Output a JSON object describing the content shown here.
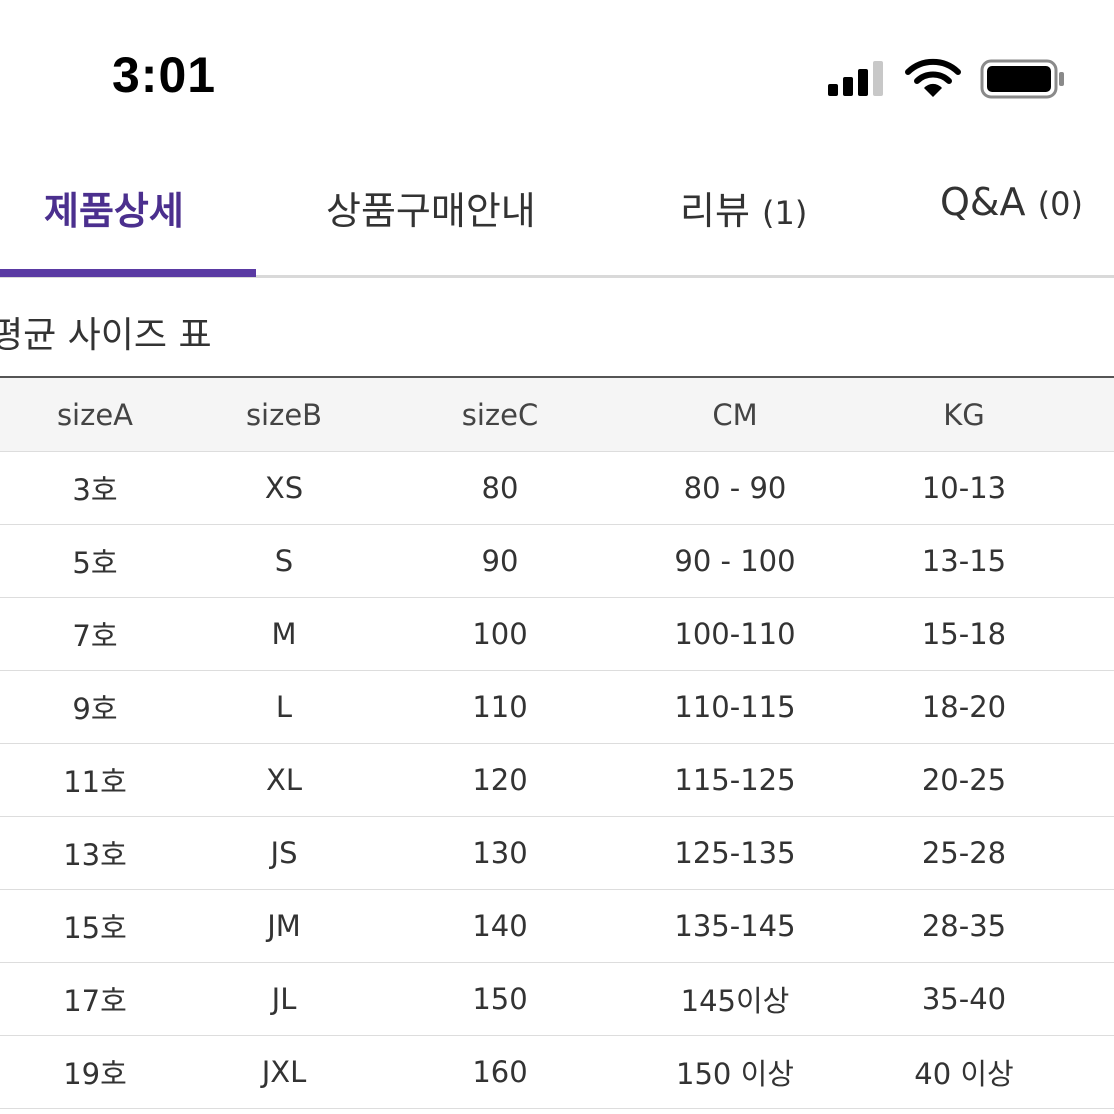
{
  "status_bar": {
    "time": "3:01",
    "icons": [
      "signal-icon",
      "wifi-icon",
      "battery-icon"
    ]
  },
  "tabs": [
    {
      "label": "제품상세",
      "count": "",
      "active": true
    },
    {
      "label": "상품구매안내",
      "count": "",
      "active": false
    },
    {
      "label": "리뷰",
      "count": "(1)",
      "active": false
    },
    {
      "label": "Q&A",
      "count": "(0)",
      "active": false
    }
  ],
  "section": {
    "title": "평균 사이즈 표"
  },
  "table": {
    "headers": [
      "sizeA",
      "sizeB",
      "sizeC",
      "CM",
      "KG"
    ],
    "rows": [
      [
        "3호",
        "XS",
        "80",
        "80 - 90",
        "10-13"
      ],
      [
        "5호",
        "S",
        "90",
        "90 - 100",
        "13-15"
      ],
      [
        "7호",
        "M",
        "100",
        "100-110",
        "15-18"
      ],
      [
        "9호",
        "L",
        "110",
        "110-115",
        "18-20"
      ],
      [
        "11호",
        "XL",
        "120",
        "115-125",
        "20-25"
      ],
      [
        "13호",
        "JS",
        "130",
        "125-135",
        "25-28"
      ],
      [
        "15호",
        "JM",
        "140",
        "135-145",
        "28-35"
      ],
      [
        "17호",
        "JL",
        "150",
        "145이상",
        "35-40"
      ],
      [
        "19호",
        "JXL",
        "160",
        "150 이상",
        "40 이상"
      ]
    ]
  },
  "colors": {
    "accent": "#5a3aa3",
    "active_tab_text": "#4b2f8e",
    "text": "#333333",
    "header_bg": "#f5f5f5",
    "divider": "#dddddd"
  }
}
